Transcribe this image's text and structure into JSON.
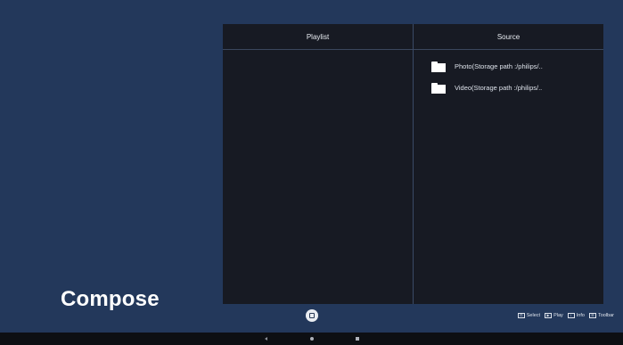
{
  "page": {
    "title": "Compose"
  },
  "playlist_panel": {
    "header": "Playlist",
    "items": []
  },
  "source_panel": {
    "header": "Source",
    "items": [
      {
        "label": "Photo(Storage path :/philips/..",
        "icon": "folder-icon"
      },
      {
        "label": "Video(Storage path :/philips/..",
        "icon": "folder-icon"
      }
    ]
  },
  "hints": [
    {
      "icon": "select-key-icon",
      "label": "Select"
    },
    {
      "icon": "play-key-icon",
      "label": "Play"
    },
    {
      "icon": "info-key-icon",
      "label": "Info"
    },
    {
      "icon": "toolbar-key-icon",
      "label": "Toolbar"
    }
  ],
  "colors": {
    "background": "#23385b",
    "panel": "#171a23",
    "nav_bar": "#0d0f13",
    "text": "#e8ecf2"
  }
}
